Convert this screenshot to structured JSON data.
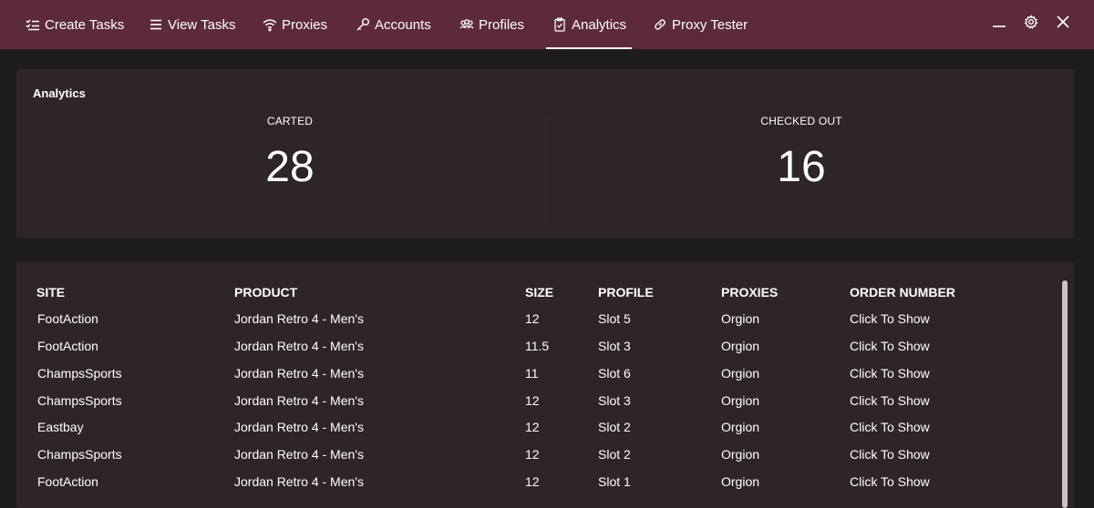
{
  "nav": {
    "items": [
      {
        "label": "Create Tasks",
        "icon": "create-tasks-icon",
        "active": false
      },
      {
        "label": "View Tasks",
        "icon": "list-icon",
        "active": false
      },
      {
        "label": "Proxies",
        "icon": "wifi-icon",
        "active": false
      },
      {
        "label": "Accounts",
        "icon": "key-icon",
        "active": false
      },
      {
        "label": "Profiles",
        "icon": "users-icon",
        "active": false
      },
      {
        "label": "Analytics",
        "icon": "clipboard-check-icon",
        "active": true
      },
      {
        "label": "Proxy Tester",
        "icon": "link-icon",
        "active": false
      }
    ]
  },
  "window_controls": {
    "minimize": "minimize-icon",
    "settings": "gear-icon",
    "close": "close-icon"
  },
  "analytics": {
    "title": "Analytics",
    "carted_label": "CARTED",
    "carted_value": "28",
    "checked_out_label": "CHECKED OUT",
    "checked_out_value": "16"
  },
  "orders": {
    "columns": [
      "SITE",
      "PRODUCT",
      "SIZE",
      "PROFILE",
      "PROXIES",
      "ORDER NUMBER"
    ],
    "rows": [
      {
        "site": "FootAction",
        "product": "Jordan Retro 4 - Men's",
        "size": "12",
        "profile": "Slot 5",
        "proxies": "Orgion",
        "order": "Click To Show"
      },
      {
        "site": "FootAction",
        "product": "Jordan Retro 4 - Men's",
        "size": "11.5",
        "profile": "Slot 3",
        "proxies": "Orgion",
        "order": "Click To Show"
      },
      {
        "site": "ChampsSports",
        "product": "Jordan Retro 4 - Men's",
        "size": "11",
        "profile": "Slot 6",
        "proxies": "Orgion",
        "order": "Click To Show"
      },
      {
        "site": "ChampsSports",
        "product": "Jordan Retro 4 - Men's",
        "size": "12",
        "profile": "Slot 3",
        "proxies": "Orgion",
        "order": "Click To Show"
      },
      {
        "site": "Eastbay",
        "product": "Jordan Retro 4 - Men's",
        "size": "12",
        "profile": "Slot 2",
        "proxies": "Orgion",
        "order": "Click To Show"
      },
      {
        "site": "ChampsSports",
        "product": "Jordan Retro 4 - Men's",
        "size": "12",
        "profile": "Slot 2",
        "proxies": "Orgion",
        "order": "Click To Show"
      },
      {
        "site": "FootAction",
        "product": "Jordan Retro 4 - Men's",
        "size": "12",
        "profile": "Slot 1",
        "proxies": "Orgion",
        "order": "Click To Show"
      }
    ]
  },
  "colors": {
    "titlebar": "#5c2a3c",
    "background": "#1e1b1c",
    "panel": "#2e2529",
    "text": "#ffffff"
  }
}
